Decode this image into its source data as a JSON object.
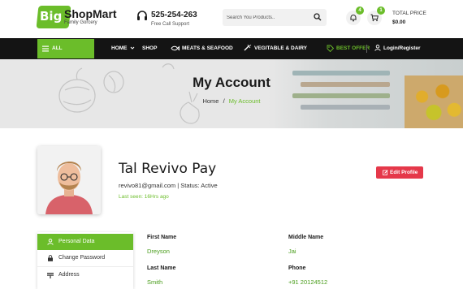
{
  "header": {
    "logo_big": "Big",
    "logo_name": "ShopMart",
    "logo_sub": "Family Gorcery",
    "phone": "525-254-263",
    "phone_sub": "Free Call Support",
    "search_placeholder": "Search You Products..",
    "notif_count": "4",
    "cart_count": "1",
    "price_label": "TOTAL PRICE",
    "price_value": "$0.00"
  },
  "nav": {
    "all_categories": "ALL CATEGORIE",
    "items": [
      "HOME",
      "SHOP",
      "MEATS & SEAFOOD",
      "VEGITABLE & DAIRY"
    ],
    "offer": "BEST OFFER",
    "login": "Login/Register"
  },
  "banner": {
    "title": "My Account",
    "crumb_home": "Home",
    "crumb_sep": "/",
    "crumb_current": "My Account"
  },
  "profile": {
    "name": "Tal Revivo Pay",
    "email_status": "revivo81@gmail.com | Status: Active",
    "last_seen": "Last seen: 16Hrs ago",
    "edit_label": "Edit Profile"
  },
  "side_menu": {
    "items": [
      "Personal Data",
      "Change Password",
      "Address"
    ]
  },
  "details": {
    "first_name_label": "First Name",
    "first_name": "Dreyson",
    "middle_name_label": "Middle Name",
    "middle_name": "Jai",
    "last_name_label": "Last Name",
    "last_name": "Smith",
    "phone_label": "Phone",
    "phone": "+91 20124512"
  },
  "colors": {
    "accent": "#6bbd2a",
    "nav_bg": "#141414",
    "edit_button": "#e5384a"
  },
  "icons": [
    "cart-logo-icon",
    "headset-icon",
    "search-icon",
    "bell-icon",
    "cart-icon",
    "menu-icon",
    "chevron-down-icon",
    "fish-icon",
    "vegetable-icon",
    "tag-icon",
    "user-icon",
    "edit-icon",
    "lock-icon",
    "address-icon"
  ]
}
